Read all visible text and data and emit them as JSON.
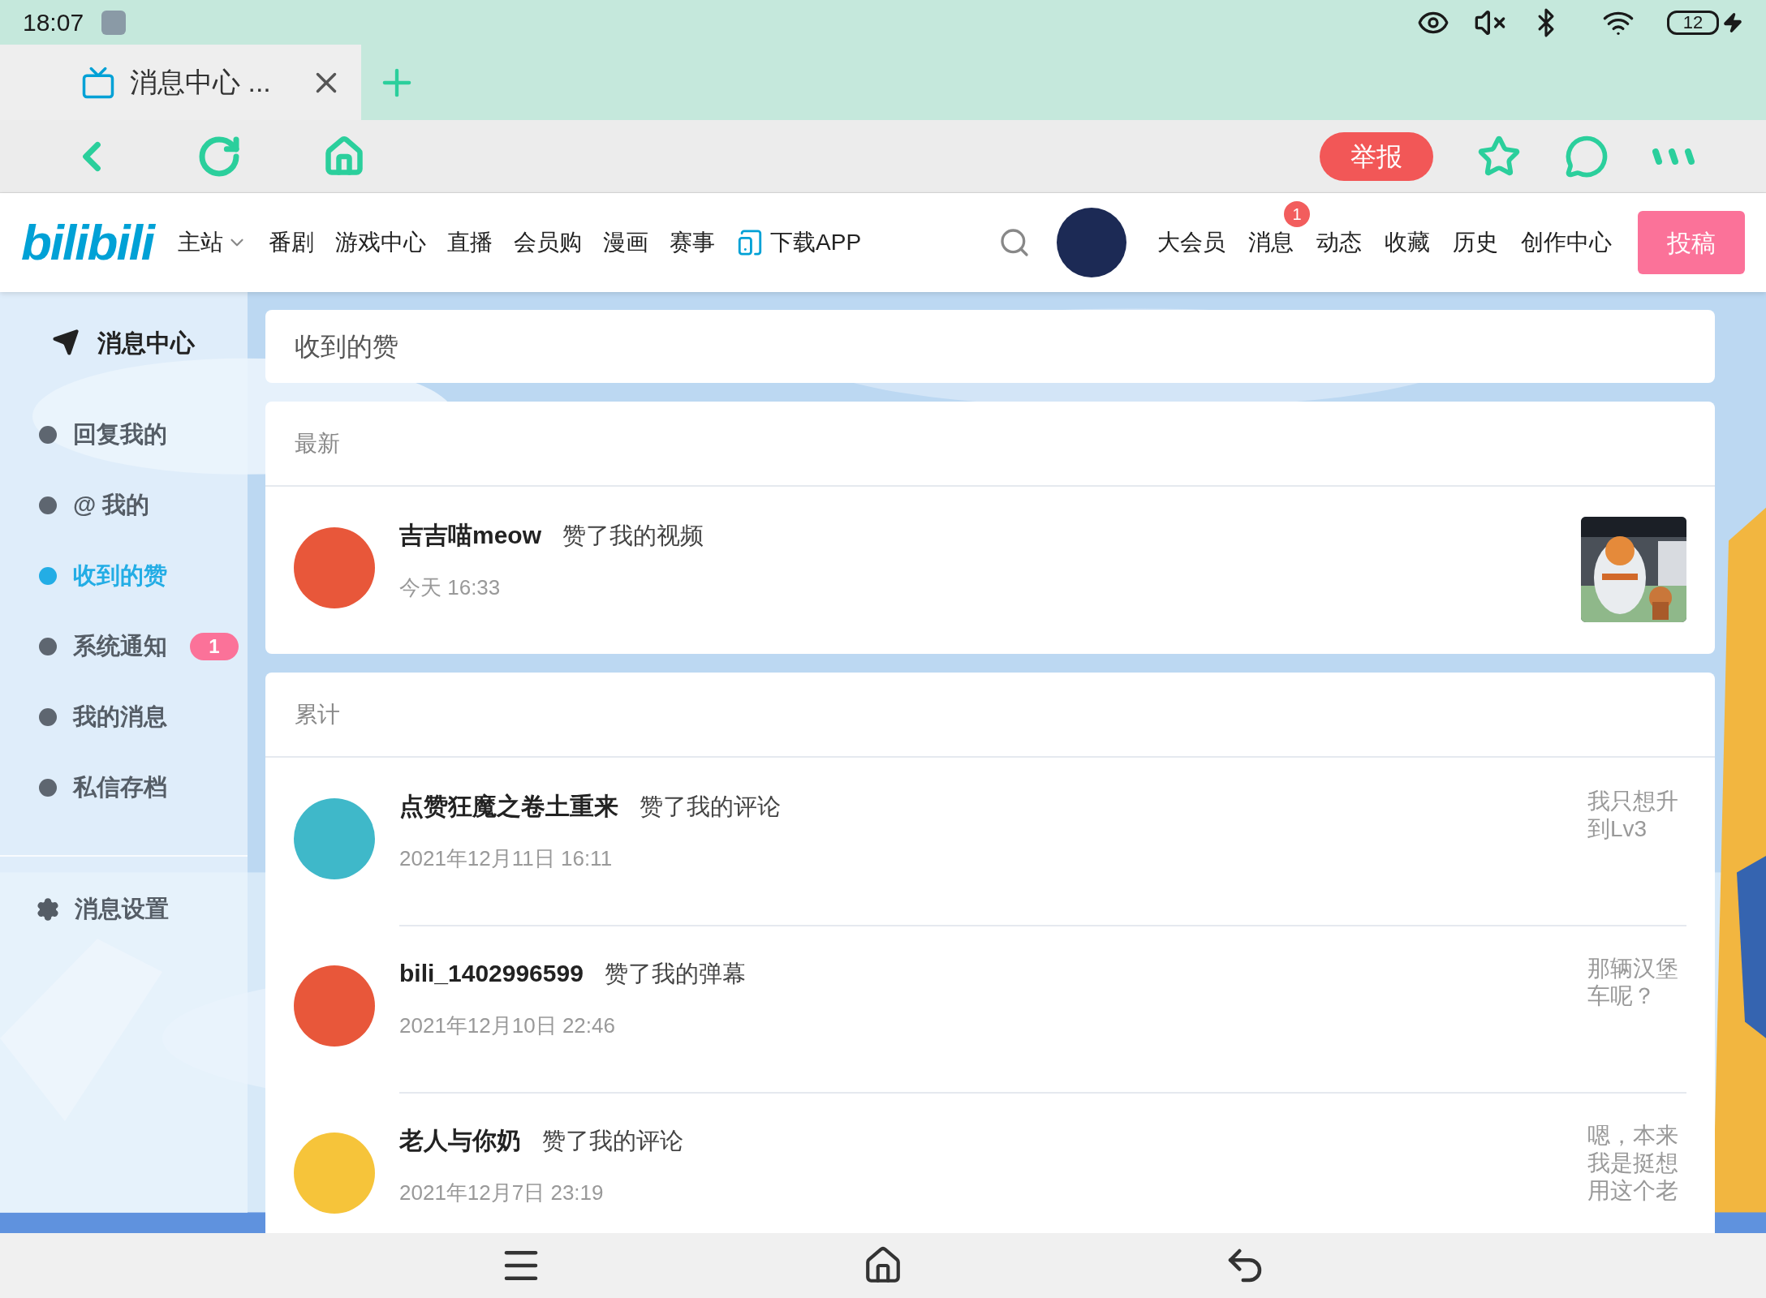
{
  "status_bar": {
    "time": "18:07",
    "battery": "12"
  },
  "browser": {
    "tabs": [
      {
        "title": "消息中心 ...",
        "selected": true
      }
    ],
    "report_button": "举报"
  },
  "site_nav": {
    "logo": "bilibili",
    "left_items": [
      {
        "label": "主站",
        "kind": "dropdown"
      },
      {
        "label": "番剧",
        "kind": "link"
      },
      {
        "label": "游戏中心",
        "kind": "link"
      },
      {
        "label": "直播",
        "kind": "link"
      },
      {
        "label": "会员购",
        "kind": "link"
      },
      {
        "label": "漫画",
        "kind": "link"
      },
      {
        "label": "赛事",
        "kind": "link"
      },
      {
        "label": "下载APP",
        "kind": "app"
      }
    ],
    "right_items": [
      {
        "label": "大会员"
      },
      {
        "label": "消息",
        "badge": "1"
      },
      {
        "label": "动态"
      },
      {
        "label": "收藏"
      },
      {
        "label": "历史"
      },
      {
        "label": "创作中心"
      }
    ],
    "upload_button": "投稿"
  },
  "sidebar": {
    "title": "消息中心",
    "items": [
      {
        "label": "回复我的",
        "selected": false
      },
      {
        "label": "@ 我的",
        "selected": false
      },
      {
        "label": "收到的赞",
        "selected": true
      },
      {
        "label": "系统通知",
        "selected": false,
        "badge": "1"
      },
      {
        "label": "我的消息",
        "selected": false
      },
      {
        "label": "私信存档",
        "selected": false
      }
    ],
    "settings": "消息设置"
  },
  "page_title": "收到的赞",
  "sections": [
    {
      "heading": "最新",
      "items": [
        {
          "user": "吉吉喵meow",
          "action": "赞了我的视频",
          "time": "今天 16:33"
        }
      ]
    },
    {
      "heading": "累计",
      "items": [
        {
          "user": "点赞狂魔之卷土重来",
          "action": "赞了我的评论",
          "time": "2021年12月11日 16:11",
          "attachment": {
            "kind": "text",
            "text": "我只想升到Lv3"
          }
        },
        {
          "user": "bili_1402996599",
          "action": "赞了我的弹幕",
          "time": "2021年12月10日 22:46",
          "attachment": {
            "kind": "text",
            "text": "那辆汉堡车呢？"
          }
        },
        {
          "user": "老人与你奶",
          "action": "赞了我的评论",
          "time": "2021年12月7日 23:19",
          "attachment": {
            "kind": "text",
            "text": "嗯，本来我是挺想用这个老"
          }
        }
      ]
    }
  ]
}
